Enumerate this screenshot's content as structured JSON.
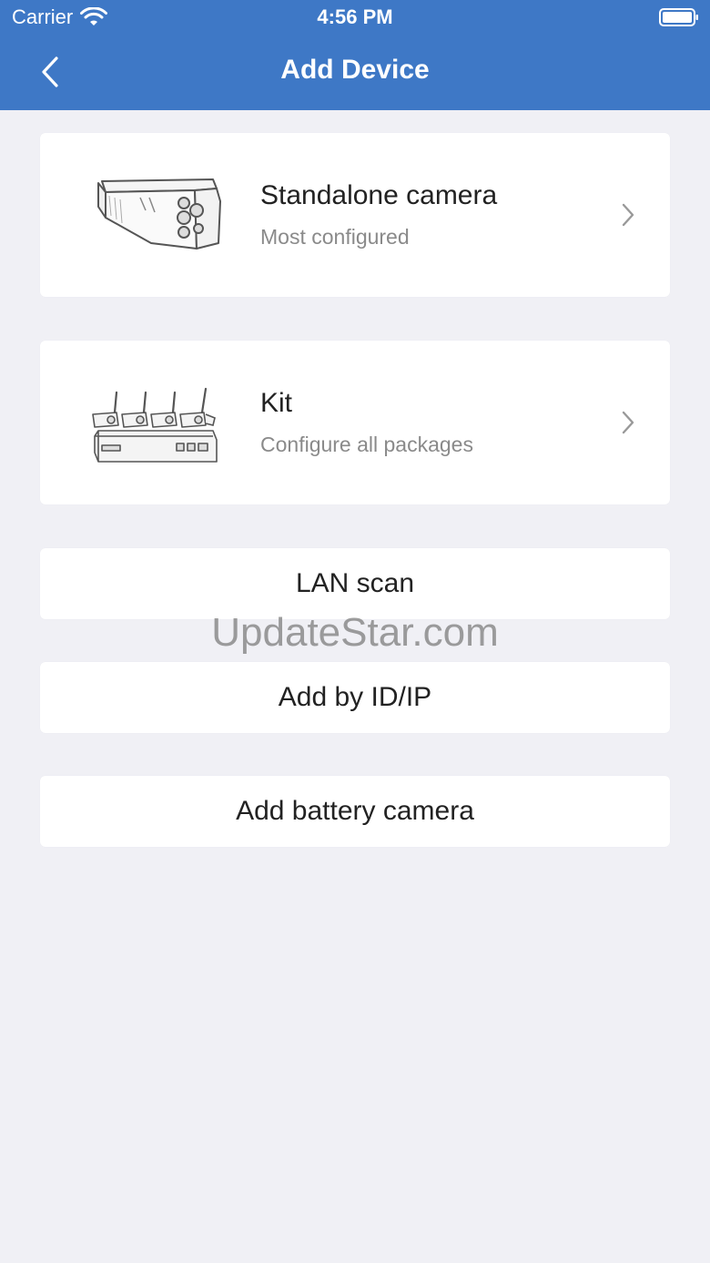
{
  "status_bar": {
    "carrier": "Carrier",
    "time": "4:56 PM",
    "wifi_icon": "wifi-icon",
    "battery_icon": "battery-icon"
  },
  "nav": {
    "title": "Add Device",
    "back_icon": "chevron-left-icon"
  },
  "devices": [
    {
      "title": "Standalone camera",
      "subtitle": "Most configured",
      "image": "bullet-camera-illustration"
    },
    {
      "title": "Kit",
      "subtitle": "Configure all packages",
      "image": "nvr-kit-illustration"
    }
  ],
  "actions": [
    {
      "label": "LAN scan"
    },
    {
      "label": "Add by ID/IP"
    },
    {
      "label": "Add battery camera"
    }
  ],
  "watermark": "UpdateStar.com",
  "colors": {
    "header": "#3e78c6",
    "background": "#f0f0f5",
    "card": "#ffffff",
    "subtitle": "#8a8a8a"
  }
}
